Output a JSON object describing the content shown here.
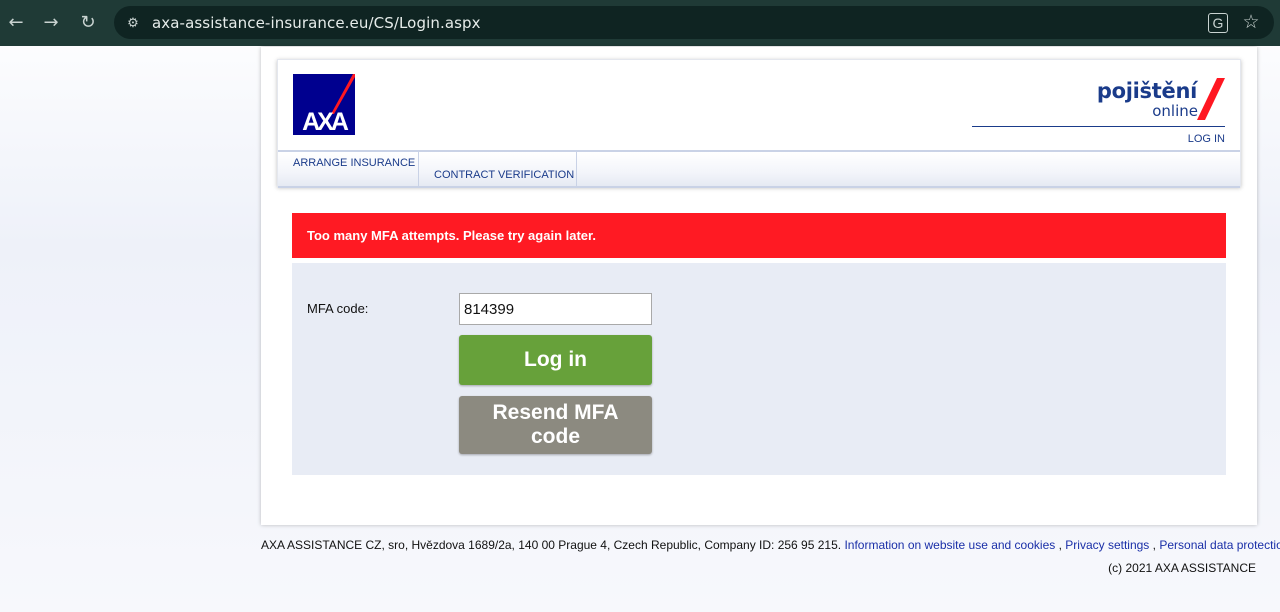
{
  "browser": {
    "url": "axa-assistance-insurance.eu/CS/Login.aspx"
  },
  "header": {
    "logo_alt": "AXA",
    "brand_title": "pojištění",
    "brand_subtitle": "online",
    "login_link": "LOG IN"
  },
  "menu": {
    "items": [
      {
        "label": "ARRANGE INSURANCE"
      },
      {
        "label": "CONTRACT VERIFICATION"
      }
    ]
  },
  "alert": {
    "message": "Too many MFA attempts. Please try again later.",
    "color": "#ff1a23"
  },
  "form": {
    "mfa_label": "MFA code:",
    "mfa_value": "814399",
    "login_button": "Log in",
    "resend_button": "Resend MFA code"
  },
  "footer": {
    "company_text": "AXA ASSISTANCE CZ, sro, Hvězdova 1689/2a, 140 00 Prague 4, Czech Republic, Company ID: 256 95 215.",
    "link_info": "Information on website use and cookies",
    "sep1": ",",
    "link_privacy": "Privacy settings",
    "sep2": ",",
    "link_personal": "Personal data protection",
    "copyright": "(c) 2021 AXA ASSISTANCE"
  },
  "colors": {
    "brand_blue": "#1a3b8a",
    "axa_blue": "#00008f",
    "axa_red": "#ff1721",
    "login_green": "#67a13a",
    "resend_gray": "#8c8a80"
  }
}
